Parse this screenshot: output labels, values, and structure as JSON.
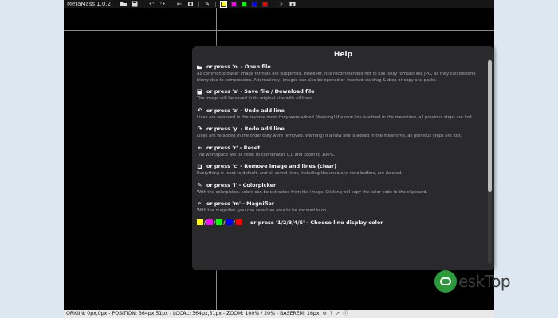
{
  "app": {
    "title": "MetaMass 1.0.2",
    "toolbar_icons": [
      "folder-open-icon",
      "save-icon",
      "undo-icon",
      "redo-icon",
      "reset-icon",
      "clipboard-image-icon",
      "colorpicker-icon",
      "magnifier-icon",
      "camera-icon"
    ],
    "color_swatches": [
      "#ffff00",
      "#ff00ff",
      "#00ff00",
      "#0000ff",
      "#ff0000"
    ],
    "active_swatch": 0
  },
  "help": {
    "title": "Help",
    "items": [
      {
        "icon": "folder-open-icon",
        "label": "or press 'o' - Open file",
        "desc": "All common browser image formats are supported. However, it is recommended not to use lossy formats like JPG, as they can become blurry due to compression. Alternatively, images can also be opened or inserted via drag & drop or copy and paste."
      },
      {
        "icon": "save-icon",
        "label": "or press 's' - Save file / Download file",
        "desc": "The image will be saved in its original size with all lines."
      },
      {
        "icon": "undo-icon",
        "label": "or press 'z' - Undo add line",
        "desc": "Lines are removed in the reverse order they were added. Warning! If a new line is added in the meantime, all previous steps are lost."
      },
      {
        "icon": "redo-icon",
        "label": "or press 'y' - Redo add line",
        "desc": "Lines are re-added in the order they were removed. Warning! If a new line is added in the meantime, all previous steps are lost."
      },
      {
        "icon": "reset-icon",
        "label": "or press 'r' - Reset",
        "desc": "The workspace will be reset to coordinates 0,0 and zoom to 100%."
      },
      {
        "icon": "clear-icon",
        "label": "or press 'c' - Remove image and lines (clear)",
        "desc": "Everything is reset to default, and all saved lines, including the undo and redo buffers, are deleted."
      },
      {
        "icon": "colorpicker-icon",
        "label": "or press 'i' - Colorpicker",
        "desc": "With the colorpicker, colors can be extracted from the image. Clicking will copy the color code to the clipboard."
      },
      {
        "icon": "magnifier-icon",
        "label": "or press 'm' - Magnifier",
        "desc": "With the magnifier, you can select an area to be zoomed in on."
      }
    ],
    "color_item": {
      "label": "or press '1/2/3/4/5' - Choose line display color",
      "colors": [
        "#ffff00",
        "#ff00ff",
        "#00ff00",
        "#0000ff",
        "#ff0000"
      ]
    }
  },
  "statusbar": {
    "text": "ORIGIN: 0px,0px - POSITION: 364px,51px - LOCAL: 364px,51px - ZOOM: 100% / 20% - BASEREM: 16px",
    "icons": [
      "settings-icon",
      "help-icon",
      "share-icon",
      "info-icon"
    ]
  },
  "watermark": {
    "text": "eskTop"
  }
}
